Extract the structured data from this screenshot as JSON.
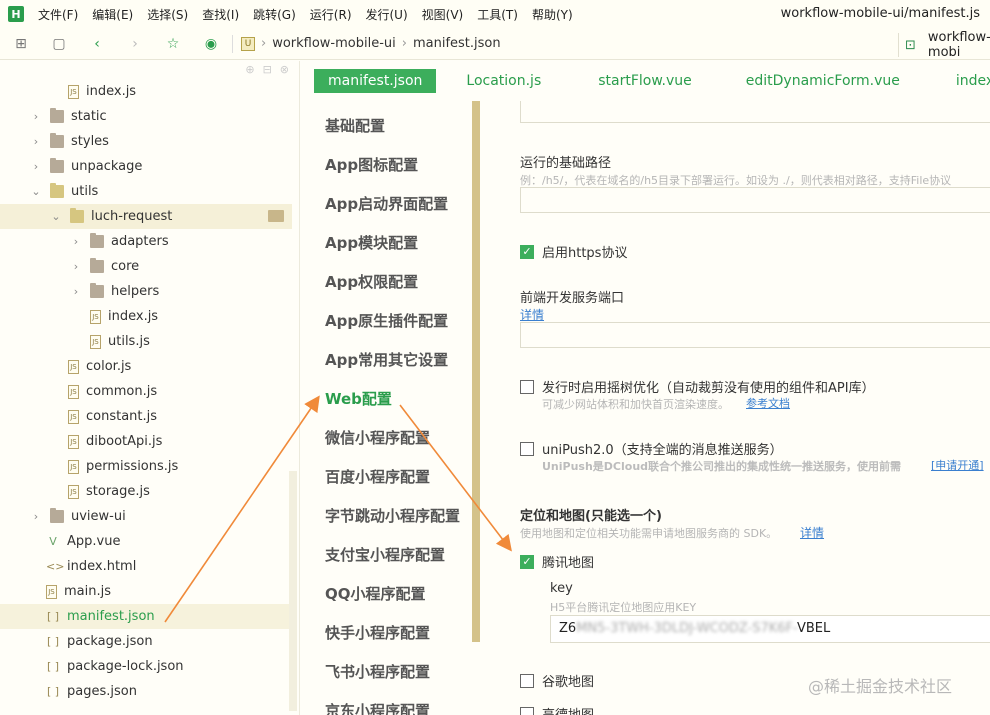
{
  "menubar": {
    "logo": "H",
    "items": [
      "文件(F)",
      "编辑(E)",
      "选择(S)",
      "查找(I)",
      "跳转(G)",
      "运行(R)",
      "发行(U)",
      "视图(V)",
      "工具(T)",
      "帮助(Y)"
    ],
    "window_title": "workflow-mobile-ui/manifest.js"
  },
  "toolbar": {
    "breadcrumb": [
      "workflow-mobile-ui",
      "manifest.json"
    ],
    "right_tab": "workflow-mobi"
  },
  "sidebar": {
    "items": [
      {
        "label": "index.js",
        "kind": "file"
      },
      {
        "label": "static",
        "kind": "folder"
      },
      {
        "label": "styles",
        "kind": "folder"
      },
      {
        "label": "unpackage",
        "kind": "folder"
      },
      {
        "label": "utils",
        "kind": "folder-open"
      },
      {
        "label": "luch-request",
        "kind": "folder-open"
      },
      {
        "label": "adapters",
        "kind": "folder"
      },
      {
        "label": "core",
        "kind": "folder"
      },
      {
        "label": "helpers",
        "kind": "folder"
      },
      {
        "label": "index.js",
        "kind": "file"
      },
      {
        "label": "utils.js",
        "kind": "file"
      },
      {
        "label": "color.js",
        "kind": "file"
      },
      {
        "label": "common.js",
        "kind": "file"
      },
      {
        "label": "constant.js",
        "kind": "file"
      },
      {
        "label": "dibootApi.js",
        "kind": "file"
      },
      {
        "label": "permissions.js",
        "kind": "file"
      },
      {
        "label": "storage.js",
        "kind": "file"
      },
      {
        "label": "uview-ui",
        "kind": "folder"
      },
      {
        "label": "App.vue",
        "kind": "vue"
      },
      {
        "label": "index.html",
        "kind": "html"
      },
      {
        "label": "main.js",
        "kind": "file"
      },
      {
        "label": "manifest.json",
        "kind": "json"
      },
      {
        "label": "package.json",
        "kind": "json"
      },
      {
        "label": "package-lock.json",
        "kind": "json"
      },
      {
        "label": "pages.json",
        "kind": "json"
      }
    ]
  },
  "tabs": [
    "manifest.json",
    "Location.js",
    "startFlow.vue",
    "editDynamicForm.vue",
    "index.html"
  ],
  "confnav": {
    "items": [
      "基础配置",
      "App图标配置",
      "App启动界面配置",
      "App模块配置",
      "App权限配置",
      "App原生插件配置",
      "App常用其它设置",
      "Web配置",
      "微信小程序配置",
      "百度小程序配置",
      "字节跳动小程序配置",
      "支付宝小程序配置",
      "QQ小程序配置",
      "快手小程序配置",
      "飞书小程序配置",
      "京东小程序配置"
    ],
    "active_index": 7
  },
  "form": {
    "base_path_label": "运行的基础路径",
    "base_path_hint": "例：/h5/，代表在域名的/h5目录下部署运行。如设为 ./，则代表相对路径，支持File协议",
    "https_label": "启用https协议",
    "https_checked": true,
    "port_label": "前端开发服务端口",
    "port_link": "详情",
    "treeshake_label": "发行时启用摇树优化（自动裁剪没有使用的组件和API库）",
    "treeshake_hint": "可减少网站体积和加快首页渲染速度。",
    "treeshake_link": "参考文档",
    "treeshake_checked": false,
    "unipush_label": "uniPush2.0（支持全端的消息推送服务）",
    "unipush_hint": "UniPush是DCloud联合个推公司推出的集成性统一推送服务，使用前需",
    "unipush_link": "[申请开通]",
    "unipush_checked": false,
    "map_title": "定位和地图(只能选一个)",
    "map_hint": "使用地图和定位相关功能需申请地图服务商的 SDK。",
    "map_link": "详情",
    "tencent_label": "腾讯地图",
    "tencent_checked": true,
    "key_label": "key",
    "key_hint": "H5平台腾讯定位地图应用KEY",
    "key_value_start": "Z6",
    "key_value_blur": "MN5-3TWH-3DLDJ-WCODZ-S7K6F-",
    "key_value_end": "VBEL",
    "google_label": "谷歌地图",
    "google_checked": false,
    "amap_label": "高德地图",
    "amap_checked": false
  },
  "watermark": "@稀土掘金技术社区",
  "colors": {
    "accent": "#3cae5c",
    "arrow": "#f08a3a",
    "link": "#3a7fcf"
  }
}
